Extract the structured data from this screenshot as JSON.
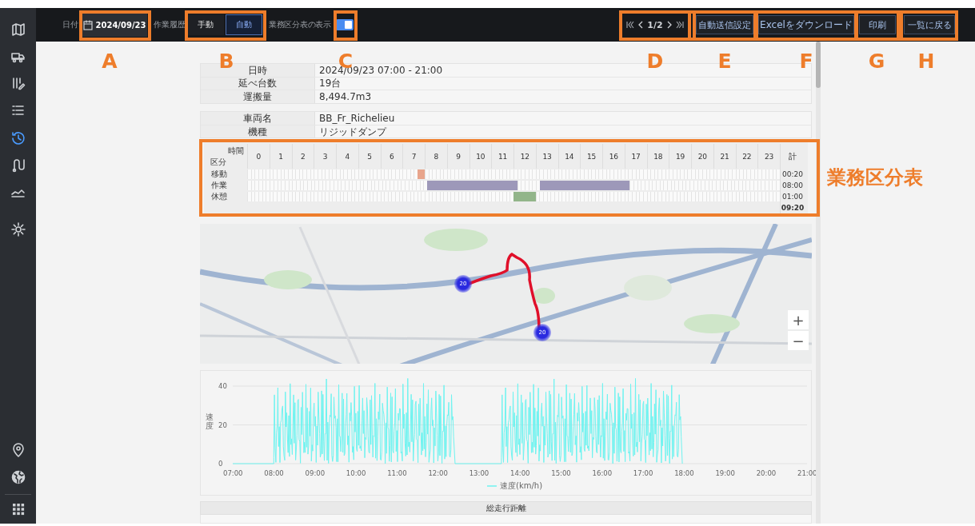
{
  "sidebar": {
    "items": [
      {
        "kind": "map",
        "selected": false
      },
      {
        "kind": "truck",
        "selected": false
      },
      {
        "kind": "edit",
        "selected": false
      },
      {
        "kind": "list",
        "selected": false
      },
      {
        "kind": "history",
        "selected": true
      },
      {
        "kind": "route",
        "selected": false
      },
      {
        "kind": "chart",
        "selected": false
      },
      {
        "kind": "gear",
        "selected": false
      }
    ],
    "bottom_items": [
      {
        "kind": "pin",
        "selected": false
      },
      {
        "kind": "globe",
        "selected": false
      },
      {
        "kind": "apps",
        "selected": false
      }
    ]
  },
  "toolbar": {
    "date_label": "日付",
    "date": "2024/09/23",
    "history_label": "作業履歴",
    "history_modes": [
      {
        "label": "手動",
        "selected": false
      },
      {
        "label": "自動",
        "selected": true
      }
    ],
    "table_toggle_label": "業務区分表の表示",
    "table_toggle_on": true,
    "pager": {
      "page": "1/2"
    },
    "buttons": [
      "自動送信設定",
      "Excelをダウンロード",
      "印刷",
      "一覧に戻る"
    ]
  },
  "summary": [
    {
      "label": "日時",
      "value": "2024/09/23 07:00 - 21:00"
    },
    {
      "label": "延べ台数",
      "value": "19台"
    },
    {
      "label": "運搬量",
      "value": "8,494.7m3"
    }
  ],
  "vehicle": [
    {
      "label": "車両名",
      "value": "BB_Fr_Richelieu"
    },
    {
      "label": "機種",
      "value": "リジッドダンプ"
    }
  ],
  "timeline": {
    "corner_top": "時間",
    "corner_bottom": "区分",
    "hours": [
      "0",
      "1",
      "2",
      "3",
      "4",
      "5",
      "6",
      "7",
      "8",
      "9",
      "10",
      "11",
      "12",
      "13",
      "14",
      "15",
      "16",
      "17",
      "18",
      "19",
      "20",
      "21",
      "22",
      "23"
    ],
    "total_header": "計",
    "rows": [
      {
        "label": "移動",
        "color": "#e8a58c",
        "total": "00:20",
        "slots": [
          false,
          false,
          false,
          false,
          false,
          false,
          false,
          false,
          false,
          false,
          false,
          false,
          false,
          false,
          false,
          false,
          false,
          false,
          false,
          false,
          false,
          false,
          false,
          false,
          false,
          false,
          false,
          false,
          false,
          false,
          false,
          false,
          false,
          false,
          false,
          false,
          false,
          false,
          false,
          false,
          false,
          false,
          false,
          false,
          false,
          false,
          true,
          true,
          false,
          false,
          false,
          false,
          false,
          false,
          false,
          false,
          false,
          false,
          false,
          false,
          false,
          false,
          false,
          false,
          false,
          false,
          false,
          false,
          false,
          false,
          false,
          false,
          false,
          false,
          false,
          false,
          false,
          false,
          false,
          false,
          false,
          false,
          false,
          false,
          false,
          false,
          false,
          false,
          false,
          false,
          false,
          false,
          false,
          false,
          false,
          false,
          false,
          false,
          false,
          false,
          false,
          false,
          false,
          false,
          false,
          false,
          false,
          false,
          false,
          false,
          false,
          false,
          false,
          false,
          false,
          false,
          false,
          false,
          false,
          false,
          false,
          false,
          false,
          false,
          false,
          false,
          false,
          false,
          false,
          false,
          false,
          false,
          false,
          false,
          false,
          false,
          false,
          false,
          false,
          false,
          false,
          false,
          false,
          false
        ]
      },
      {
        "label": "作業",
        "color": "#9d98b9",
        "total": "08:00",
        "slots": [
          false,
          false,
          false,
          false,
          false,
          false,
          false,
          false,
          false,
          false,
          false,
          false,
          false,
          false,
          false,
          false,
          false,
          false,
          false,
          false,
          false,
          false,
          false,
          false,
          false,
          false,
          false,
          false,
          false,
          false,
          false,
          false,
          false,
          false,
          false,
          false,
          false,
          false,
          false,
          false,
          false,
          false,
          false,
          false,
          false,
          false,
          false,
          false,
          true,
          true,
          true,
          true,
          true,
          true,
          true,
          true,
          true,
          true,
          true,
          true,
          true,
          true,
          true,
          true,
          true,
          true,
          true,
          true,
          true,
          true,
          true,
          true,
          false,
          false,
          false,
          false,
          false,
          false,
          true,
          true,
          true,
          true,
          true,
          true,
          true,
          true,
          true,
          true,
          true,
          true,
          true,
          true,
          true,
          true,
          true,
          true,
          true,
          true,
          true,
          true,
          true,
          true,
          false,
          false,
          false,
          false,
          false,
          false,
          false,
          false,
          false,
          false,
          false,
          false,
          false,
          false,
          false,
          false,
          false,
          false,
          false,
          false,
          false,
          false,
          false,
          false,
          false,
          false,
          false,
          false,
          false,
          false,
          false,
          false,
          false,
          false,
          false,
          false,
          false,
          false,
          false,
          false
        ]
      },
      {
        "label": "休憩",
        "color": "#92b58a",
        "total": "01:00",
        "slots": [
          false,
          false,
          false,
          false,
          false,
          false,
          false,
          false,
          false,
          false,
          false,
          false,
          false,
          false,
          false,
          false,
          false,
          false,
          false,
          false,
          false,
          false,
          false,
          false,
          false,
          false,
          false,
          false,
          false,
          false,
          false,
          false,
          false,
          false,
          false,
          false,
          false,
          false,
          false,
          false,
          false,
          false,
          false,
          false,
          false,
          false,
          false,
          false,
          false,
          false,
          false,
          false,
          false,
          false,
          false,
          false,
          false,
          false,
          false,
          false,
          false,
          false,
          false,
          false,
          false,
          false,
          false,
          false,
          false,
          false,
          false,
          false,
          true,
          true,
          true,
          true,
          true,
          true,
          false,
          false,
          false,
          false,
          false,
          false,
          false,
          false,
          false,
          false,
          false,
          false,
          false,
          false,
          false,
          false,
          false,
          false,
          false,
          false,
          false,
          false,
          false,
          false,
          false,
          false,
          false,
          false,
          false,
          false,
          false,
          false,
          false,
          false,
          false,
          false,
          false,
          false,
          false,
          false,
          false,
          false,
          false,
          false,
          false,
          false,
          false,
          false,
          false,
          false,
          false,
          false,
          false,
          false,
          false,
          false,
          false,
          false,
          false,
          false,
          false,
          false,
          false,
          false,
          false,
          false
        ]
      }
    ],
    "grand_total": "09:20"
  },
  "map": {
    "clusters": [
      {
        "count": "20"
      },
      {
        "count": "20"
      }
    ],
    "zoom_in": "+",
    "zoom_out": "−"
  },
  "speed_chart": {
    "ylabel": "速度",
    "yticks": [
      "40",
      "20",
      "0"
    ],
    "xticks": [
      "07:00",
      "08:00",
      "09:00",
      "10:00",
      "11:00",
      "12:00",
      "13:00",
      "14:00",
      "15:00",
      "16:00",
      "17:00",
      "18:00",
      "19:00",
      "20:00",
      "21:00"
    ],
    "legend": "速度(km/h)"
  },
  "distance_table": {
    "header": "総走行距離"
  },
  "annotations": {
    "markers": [
      {
        "letter": "A"
      },
      {
        "letter": "B"
      },
      {
        "letter": "C"
      },
      {
        "letter": "D"
      },
      {
        "letter": "E"
      },
      {
        "letter": "F"
      },
      {
        "letter": "G"
      },
      {
        "letter": "H"
      }
    ],
    "timeline_label": "業務区分表"
  }
}
